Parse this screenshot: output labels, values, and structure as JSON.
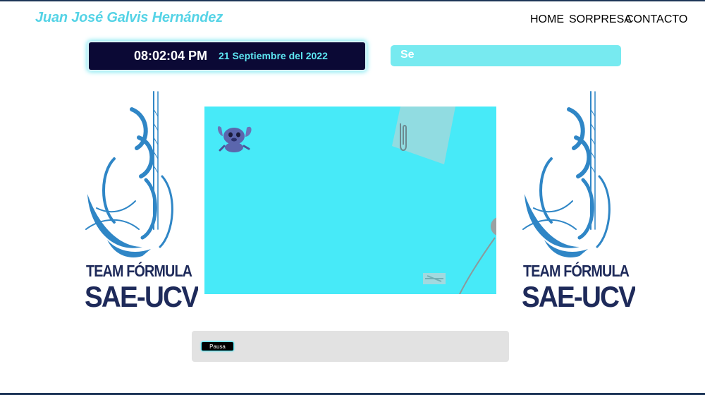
{
  "header": {
    "title": "Juan José Galvis Hernández",
    "nav": [
      {
        "label": "HOME"
      },
      {
        "label": "SORPRESA"
      },
      {
        "label": "CONTACTO"
      }
    ]
  },
  "clock": {
    "time": "08:02:04 PM",
    "date": "21 Septiembre del 2022"
  },
  "marquee": {
    "text": "Se"
  },
  "logo": {
    "line1": "TEAM FÓRMULA",
    "line2": "SAE-UCV"
  },
  "video": {
    "background_color": "#47eaf8"
  },
  "controls": {
    "pause_label": "Pausa"
  },
  "colors": {
    "accent": "#55d3e6",
    "clock_bg": "#0b0935",
    "logo_navy": "#1e2a5a",
    "logo_blue": "#2f86c6"
  }
}
